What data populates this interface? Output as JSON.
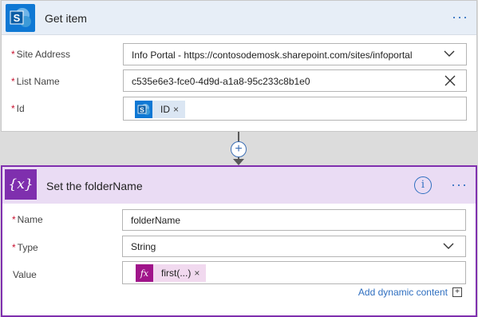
{
  "get_item": {
    "title": "Get item",
    "fields": {
      "site_address": {
        "label": "Site Address",
        "value": "Info Portal - https://contosodemosk.sharepoint.com/sites/infoportal"
      },
      "list_name": {
        "label": "List Name",
        "value": "c535e6e3-fce0-4d9d-a1a8-95c233c8b1e0"
      },
      "id": {
        "label": "Id",
        "token": "ID",
        "token_remove": "×"
      }
    }
  },
  "connector": {
    "plus": "+"
  },
  "set_variable": {
    "icon_text": "{x}",
    "title": "Set the folderName",
    "info_glyph": "i",
    "fields": {
      "name": {
        "label": "Name",
        "value": "folderName"
      },
      "type": {
        "label": "Type",
        "value": "String"
      },
      "value": {
        "label": "Value",
        "token": "first(...)",
        "token_icon": "fx",
        "token_remove": "×"
      }
    },
    "add_dynamic": "Add dynamic content",
    "add_dynamic_plus": "+"
  },
  "required_marker": "*",
  "more_menu": "···",
  "colors": {
    "sharepoint_blue": "#0f78d4",
    "variable_purple": "#7f2fae",
    "variable_header": "#eadcf4",
    "get_item_header": "#e7eef7",
    "link_blue": "#2f6fc0",
    "required_red": "#c8102e",
    "sp_token_bg": "#dbe6f3",
    "fx_token_bg": "#f1d9ef"
  },
  "icons": [
    "sharepoint-icon",
    "chevron-down-icon",
    "clear-icon",
    "variable-icon",
    "info-icon",
    "function-icon",
    "add-icon"
  ]
}
